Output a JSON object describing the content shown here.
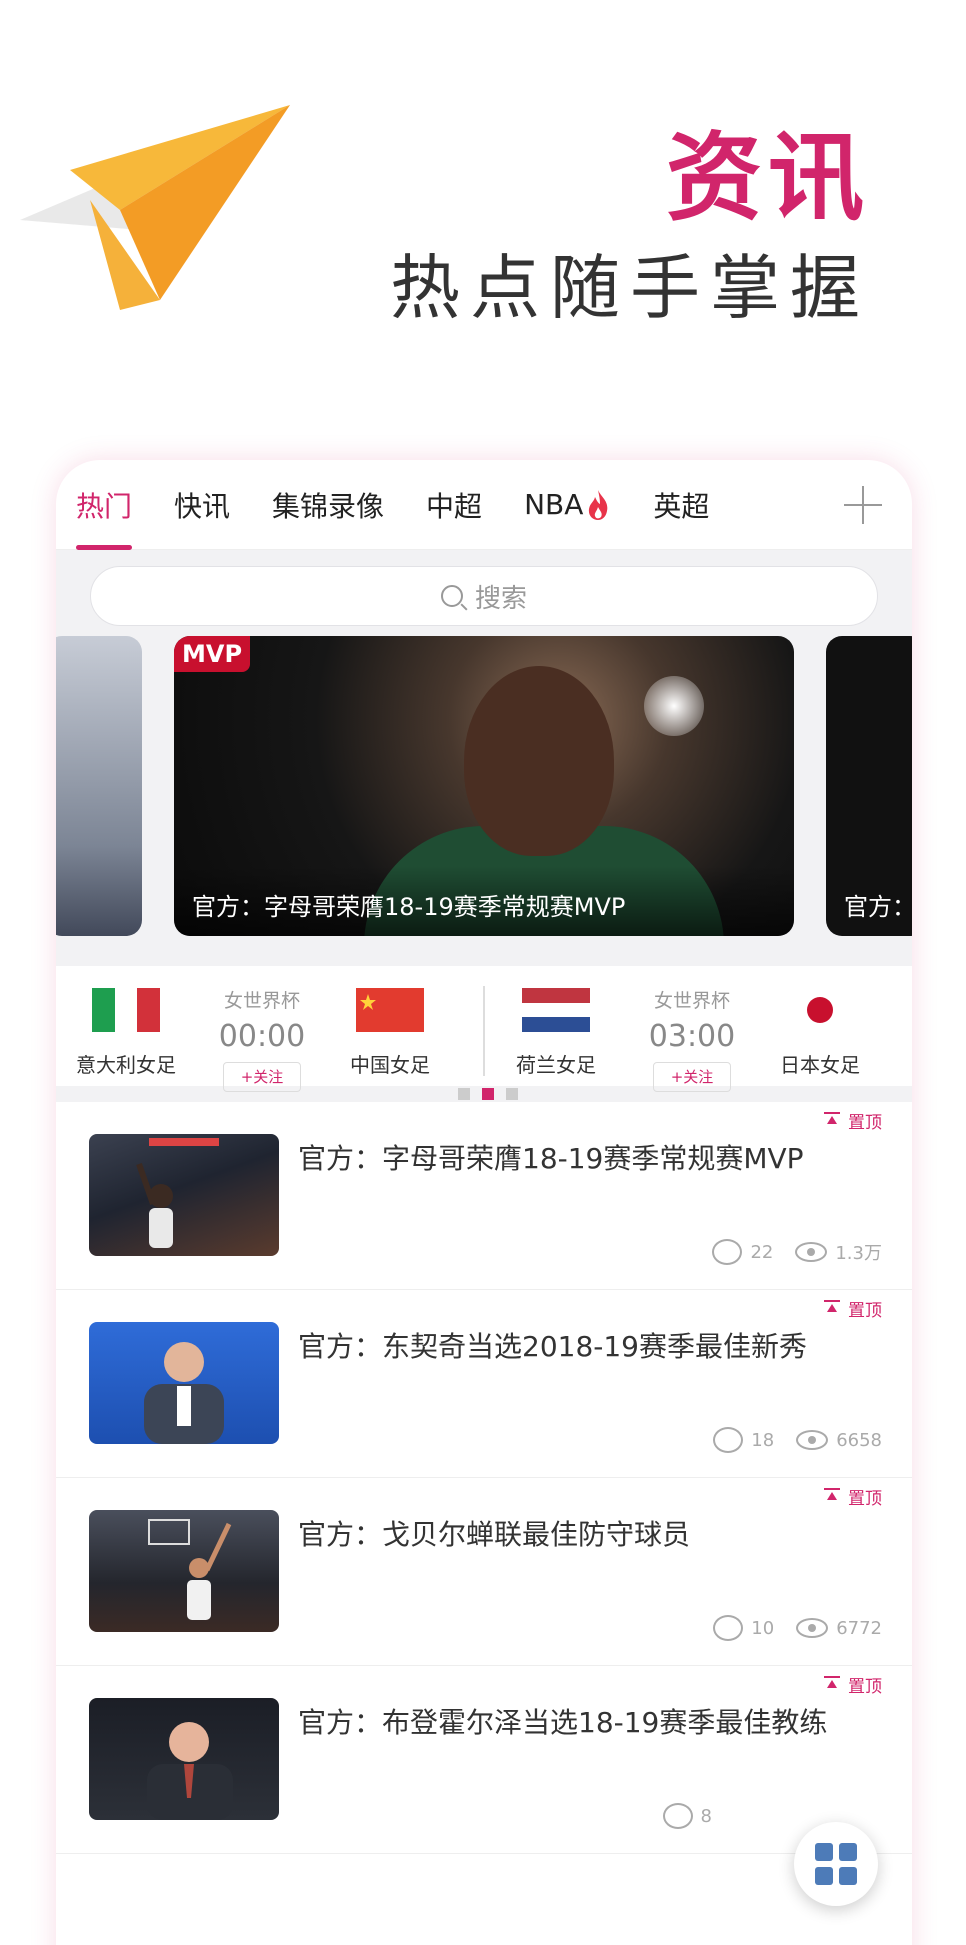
{
  "promo": {
    "title": "资讯",
    "subtitle": "热点随手掌握"
  },
  "tabs": [
    {
      "label": "热门",
      "active": true
    },
    {
      "label": "快讯"
    },
    {
      "label": "集锦录像"
    },
    {
      "label": "中超"
    },
    {
      "label": "NBA",
      "icon": "fire-icon"
    },
    {
      "label": "英超"
    }
  ],
  "search": {
    "placeholder": "搜索"
  },
  "carousel": {
    "badge": "MVP",
    "main_caption": "官方：字母哥荣膺18-19赛季常规赛MVP",
    "right_caption": "官方："
  },
  "matches": [
    {
      "home": "意大利女足",
      "competition": "女世界杯",
      "time": "00:00",
      "away": "中国女足",
      "follow": "+关注"
    },
    {
      "home": "荷兰女足",
      "competition": "女世界杯",
      "time": "03:00",
      "away": "日本女足",
      "follow": "+关注"
    }
  ],
  "news": [
    {
      "pin": "置顶",
      "headline": "官方：字母哥荣膺18-19赛季常规赛MVP",
      "comments": "22",
      "views": "1.3万"
    },
    {
      "pin": "置顶",
      "headline": "官方：东契奇当选2018-19赛季最佳新秀",
      "comments": "18",
      "views": "6658"
    },
    {
      "pin": "置顶",
      "headline": "官方：戈贝尔蝉联最佳防守球员",
      "comments": "10",
      "views": "6772"
    },
    {
      "pin": "置顶",
      "headline": "官方：布登霍尔泽当选18-19赛季最佳教练",
      "comments": "8",
      "views": ""
    }
  ],
  "colors": {
    "accent": "#d1256b",
    "plane": "#f5a623"
  }
}
